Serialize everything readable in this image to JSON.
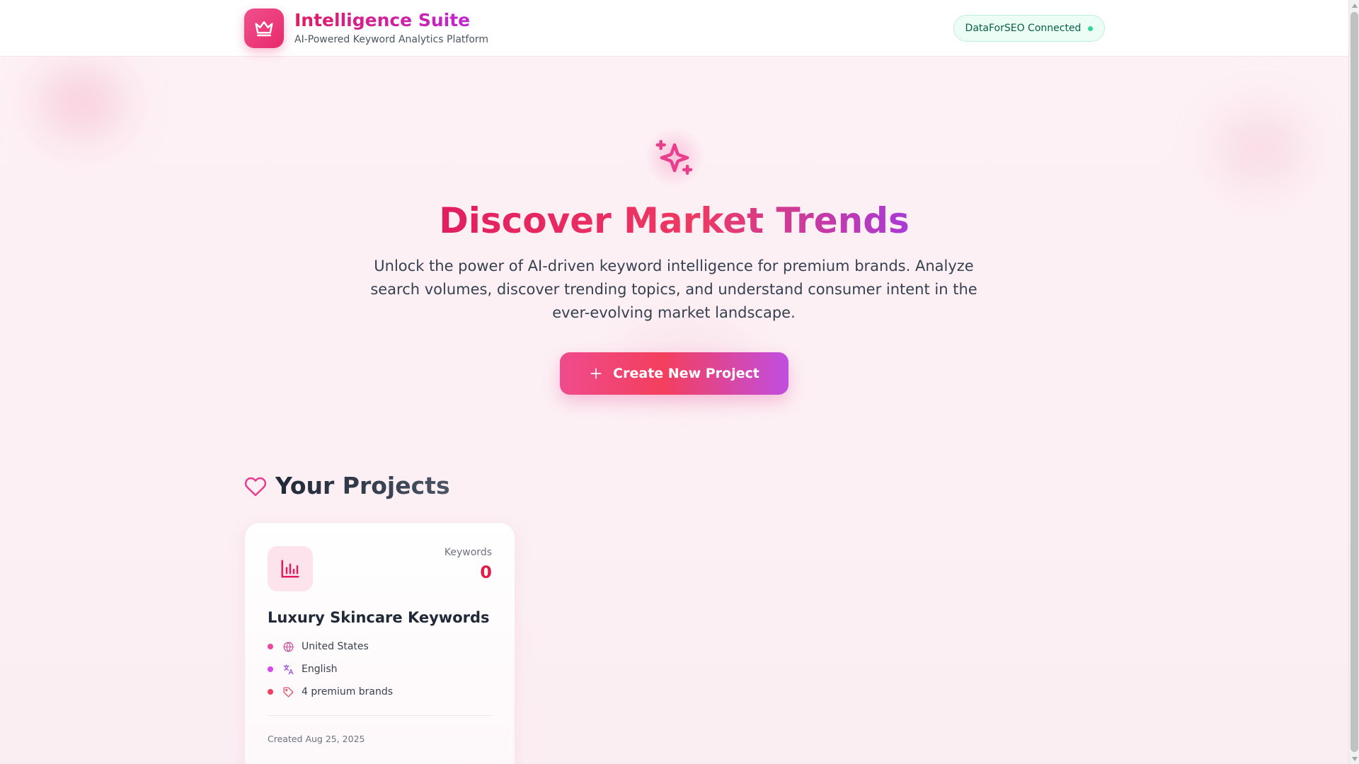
{
  "header": {
    "title": "Intelligence Suite",
    "subtitle": "AI-Powered Keyword Analytics Platform",
    "status": "DataForSEO Connected",
    "logo_icon": "crown-icon"
  },
  "hero": {
    "icon": "sparkles-icon",
    "title": "Discover Market Trends",
    "description": "Unlock the power of AI-driven keyword intelligence for premium brands. Analyze search volumes, discover trending topics, and understand consumer intent in the ever-evolving market landscape.",
    "cta_label": "Create New Project",
    "cta_icon": "plus-icon"
  },
  "projects": {
    "section_title": "Your Projects",
    "section_icon": "heart-icon",
    "items": [
      {
        "name": "Luxury Skincare Keywords",
        "keywords_label": "Keywords",
        "keywords_count": "0",
        "location": "United States",
        "language": "English",
        "brands": "4 premium brands",
        "created": "Created Aug 25, 2025",
        "icon": "bar-chart-icon"
      }
    ]
  },
  "colors": {
    "brand_pink": "#e11d60",
    "brand_purple": "#c026d3",
    "status_green": "#34d399",
    "page_bg": "#fdf0f4"
  }
}
